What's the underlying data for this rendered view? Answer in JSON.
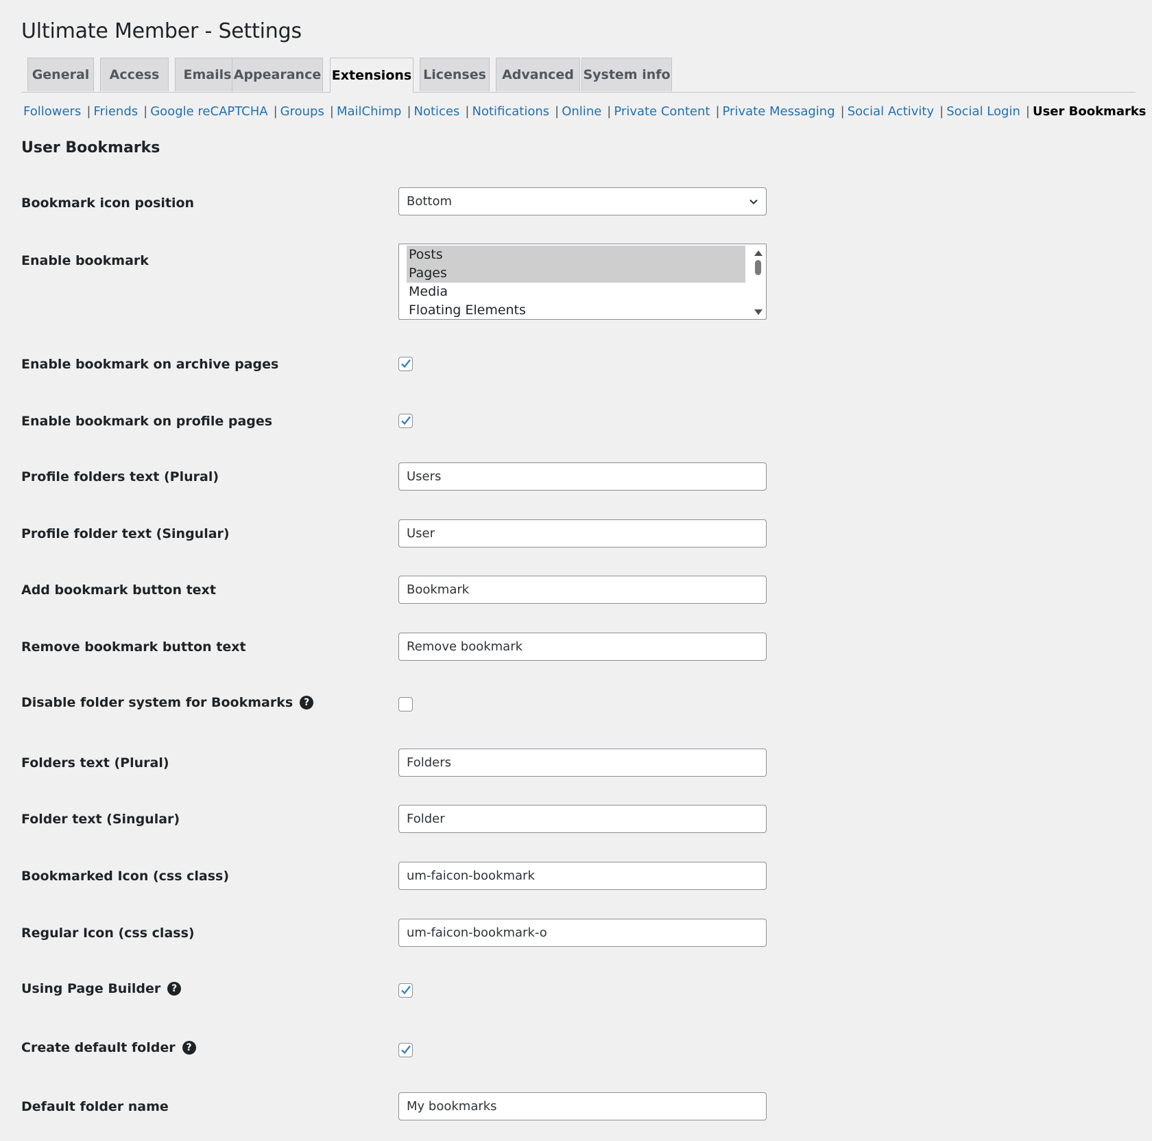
{
  "page_title": "Ultimate Member - Settings",
  "tabs": [
    {
      "label": "General"
    },
    {
      "label": "Access"
    },
    {
      "label": "Emails"
    },
    {
      "label": "Appearance"
    },
    {
      "label": "Extensions",
      "active": true
    },
    {
      "label": "Licenses"
    },
    {
      "label": "Advanced"
    },
    {
      "label": "System info"
    }
  ],
  "subnav": {
    "links": [
      "Followers",
      "Friends",
      "Google reCAPTCHA",
      "Groups",
      "MailChimp",
      "Notices",
      "Notifications",
      "Online",
      "Private Content",
      "Private Messaging",
      "Social Activity",
      "Social Login"
    ],
    "current": "User Bookmarks"
  },
  "section_title": "User Bookmarks",
  "fields": {
    "icon_position": {
      "label": "Bookmark icon position",
      "value": "Bottom"
    },
    "enable_bookmark": {
      "label": "Enable bookmark",
      "options": [
        "Posts",
        "Pages",
        "Media",
        "Floating Elements"
      ],
      "selected": [
        "Posts",
        "Pages"
      ]
    },
    "archive_pages": {
      "label": "Enable bookmark on archive pages",
      "checked": true
    },
    "profile_pages": {
      "label": "Enable bookmark on profile pages",
      "checked": true
    },
    "profile_folders_plural": {
      "label": "Profile folders text (Plural)",
      "value": "Users"
    },
    "profile_folder_singular": {
      "label": "Profile folder text (Singular)",
      "value": "User"
    },
    "add_button_text": {
      "label": "Add bookmark button text",
      "value": "Bookmark"
    },
    "remove_button_text": {
      "label": "Remove bookmark button text",
      "value": "Remove bookmark"
    },
    "disable_folders": {
      "label": "Disable folder system for Bookmarks",
      "checked": false,
      "help": "?"
    },
    "folders_plural": {
      "label": "Folders text (Plural)",
      "value": "Folders"
    },
    "folder_singular": {
      "label": "Folder text (Singular)",
      "value": "Folder"
    },
    "bookmarked_icon": {
      "label": "Bookmarked Icon (css class)",
      "value": "um-faicon-bookmark"
    },
    "regular_icon": {
      "label": "Regular Icon (css class)",
      "value": "um-faicon-bookmark-o"
    },
    "page_builder": {
      "label": "Using Page Builder",
      "checked": true,
      "help": "?"
    },
    "default_folder": {
      "label": "Create default folder",
      "checked": true,
      "help": "?"
    },
    "default_folder_name": {
      "label": "Default folder name",
      "value": "My bookmarks"
    }
  },
  "colors": {
    "accent": "#2271b1",
    "background": "#f0f0f1",
    "check": "#3582c4"
  }
}
